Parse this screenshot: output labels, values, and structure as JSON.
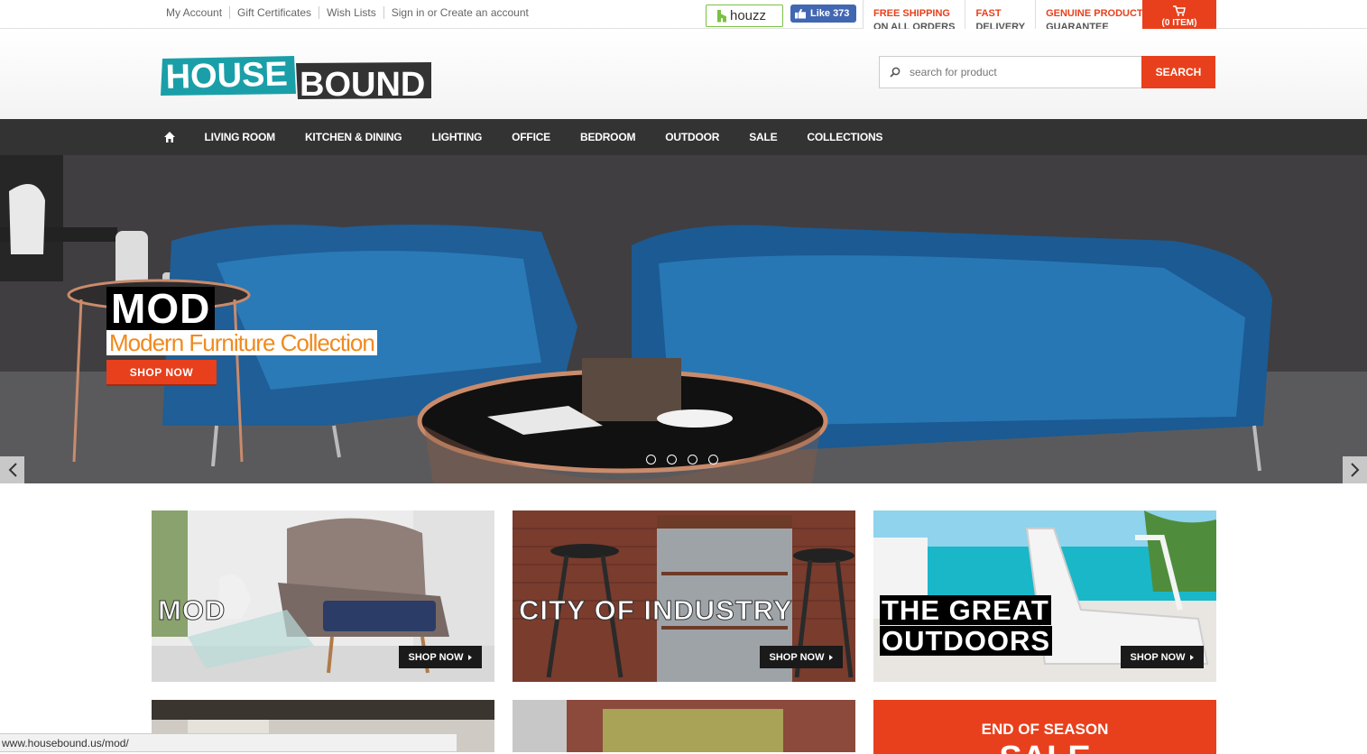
{
  "top_links": [
    "My Account",
    "Gift Certificates",
    "Wish Lists",
    "Sign in or Create an account"
  ],
  "houzz_label": "houzz",
  "fb_like": "Like 373",
  "benefits": [
    {
      "line1": "FREE SHIPPING",
      "line2": "ON ALL ORDERS"
    },
    {
      "line1": "FAST",
      "line2": "DELIVERY"
    },
    {
      "line1": "GENUINE PRODUCT",
      "line2": "GUARANTEE"
    }
  ],
  "cart_label": "(0 ITEM)",
  "logo": {
    "word1": "HOUSE",
    "word2": "BOUND",
    "teal": "#1a9fa8",
    "dark": "#333333"
  },
  "search": {
    "placeholder": "search for product",
    "button": "SEARCH"
  },
  "nav": [
    "LIVING ROOM",
    "KITCHEN & DINING",
    "LIGHTING",
    "OFFICE",
    "BEDROOM",
    "OUTDOOR",
    "SALE",
    "COLLECTIONS"
  ],
  "hero": {
    "title": "MOD",
    "subtitle": "Modern Furniture Collection",
    "cta": "SHOP NOW",
    "slide_count": 4
  },
  "tiles": [
    {
      "title": "MOD",
      "cta": "SHOP NOW"
    },
    {
      "title": "CITY OF INDUSTRY",
      "cta": "SHOP NOW"
    },
    {
      "title_line1": "THE GREAT",
      "title_line2": "OUTDOORS",
      "cta": "SHOP NOW"
    }
  ],
  "sale": {
    "line1": "END OF SEASON",
    "line2": "SALE"
  },
  "status_url": "www.housebound.us/mod/",
  "colors": {
    "accent": "#e8401c",
    "nav_bg": "#333333",
    "teal": "#1a9fa8",
    "orange_text": "#f08a1e"
  }
}
